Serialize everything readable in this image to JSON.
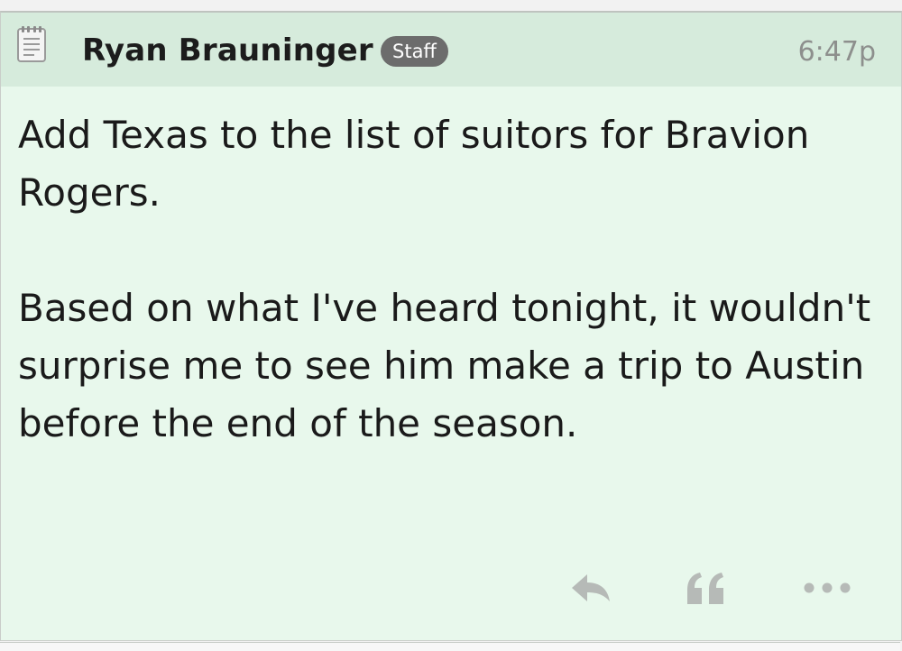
{
  "post": {
    "author": "Ryan Brauninger",
    "badge": "Staff",
    "time": "6:47p",
    "paragraphs": [
      "Add Texas to the list of suitors for Bravion Rogers.",
      "Based on what I've heard tonight, it wouldn't surprise me to see him make a trip to Austin before the end of the season."
    ],
    "icons": {
      "post_type": "notepad-icon",
      "reply": "reply-icon",
      "quote": "quote-icon",
      "more": "more-options-icon"
    }
  },
  "colors": {
    "post_background": "#e8f8ec",
    "header_background": "#d6ebdc",
    "badge_background": "#6c6c6c",
    "timestamp": "#8d8f8d",
    "action_icons": "#b6bab7"
  }
}
